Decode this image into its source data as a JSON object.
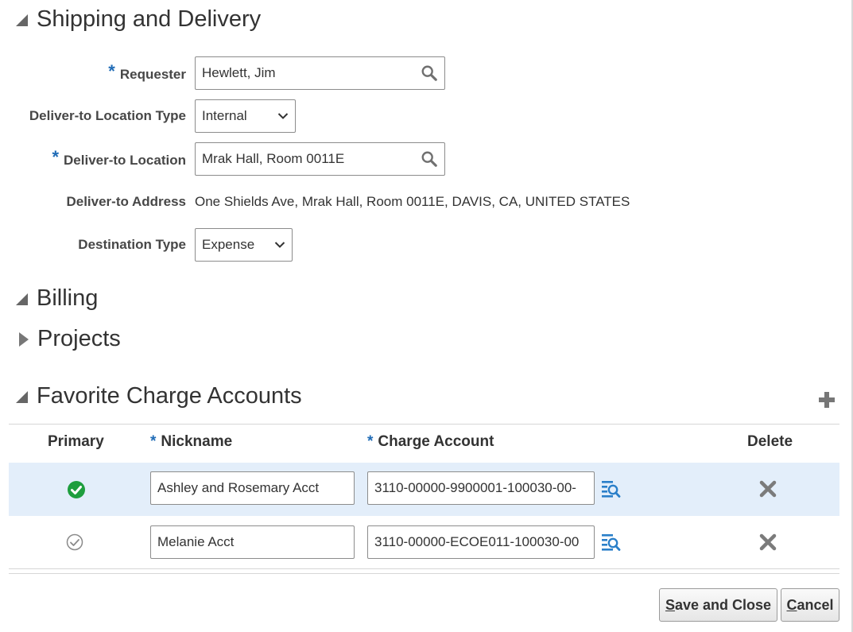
{
  "shipping": {
    "title": "Shipping and Delivery",
    "requester_label": "Requester",
    "requester_value": "Hewlett, Jim",
    "location_type_label": "Deliver-to Location Type",
    "location_type_value": "Internal",
    "location_label": "Deliver-to Location",
    "location_value": "Mrak Hall, Room 0011E",
    "address_label": "Deliver-to Address",
    "address_value": "One Shields Ave, Mrak Hall, Room 0011E, DAVIS, CA, UNITED STATES",
    "destination_type_label": "Destination Type",
    "destination_type_value": "Expense",
    "required_marker": "*"
  },
  "billing": {
    "title": "Billing"
  },
  "projects": {
    "title": "Projects"
  },
  "favorites": {
    "title": "Favorite Charge Accounts",
    "columns": {
      "primary": "Primary",
      "nickname": "Nickname",
      "charge_account": "Charge Account",
      "delete": "Delete"
    },
    "rows": [
      {
        "nickname": "Ashley and Rosemary Acct",
        "charge_account": "3110-00000-9900001-100030-00-",
        "primary": true
      },
      {
        "nickname": "Melanie Acct",
        "charge_account": "3110-00000-ECOE011-100030-00",
        "primary": false
      }
    ]
  },
  "buttons": {
    "save_close_mnemonic": "S",
    "save_close_rest": "ave and Close",
    "cancel_mnemonic": "C",
    "cancel_rest": "ancel"
  },
  "colors": {
    "required": "#1f6bb6",
    "primary_check": "#1e9e3e",
    "selected_row": "#e3eefa",
    "link_icon": "#2a7fc9"
  }
}
